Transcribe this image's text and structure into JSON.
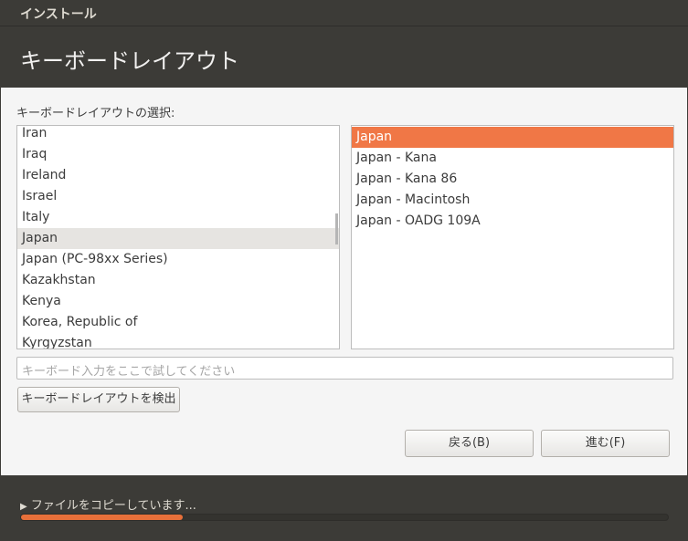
{
  "window": {
    "title": "インストール"
  },
  "header": {
    "title": "キーボードレイアウト"
  },
  "main": {
    "select_label": "キーボードレイアウトの選択:",
    "layouts": [
      "Iran",
      "Iraq",
      "Ireland",
      "Israel",
      "Italy",
      "Japan",
      "Japan (PC-98xx Series)",
      "Kazakhstan",
      "Kenya",
      "Korea, Republic of",
      "Kyrgyzstan"
    ],
    "selected_layout": "Japan",
    "variants": [
      "Japan",
      "Japan - Kana",
      "Japan - Kana 86",
      "Japan - Macintosh",
      "Japan - OADG 109A"
    ],
    "selected_variant": "Japan",
    "test_placeholder": "キーボード入力をここで試してください",
    "detect_label": "キーボードレイアウトを検出",
    "back_label": "戻る(B)",
    "forward_label": "進む(F)"
  },
  "footer": {
    "status": "ファイルをコピーしています...",
    "progress_percent": 25,
    "accent": "#e8703a"
  }
}
